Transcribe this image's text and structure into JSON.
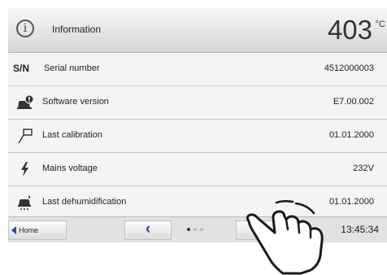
{
  "header": {
    "icon": "info-circle-icon",
    "title": "Information",
    "temperature": "403",
    "temperature_unit": "°C"
  },
  "rows": [
    {
      "icon": "sn-text",
      "icon_text": "S/N",
      "label": "Serial number",
      "value": "4512000003"
    },
    {
      "icon": "software-icon",
      "label": "Software version",
      "value": "E7.00.002"
    },
    {
      "icon": "calibration-icon",
      "label": "Last calibration",
      "value": "01.01.2000"
    },
    {
      "icon": "lightning-icon",
      "label": "Mains voltage",
      "value": "232V"
    },
    {
      "icon": "dehumidification-icon",
      "label": "Last dehumidification",
      "value": "01.01.2000"
    }
  ],
  "footer": {
    "home_label": "Home",
    "back_icon": "chevron-left-icon",
    "pagination": {
      "pages": 3,
      "current": 1
    },
    "time": "13:45:34"
  },
  "overlay": {
    "icon": "pointing-hand-icon"
  }
}
